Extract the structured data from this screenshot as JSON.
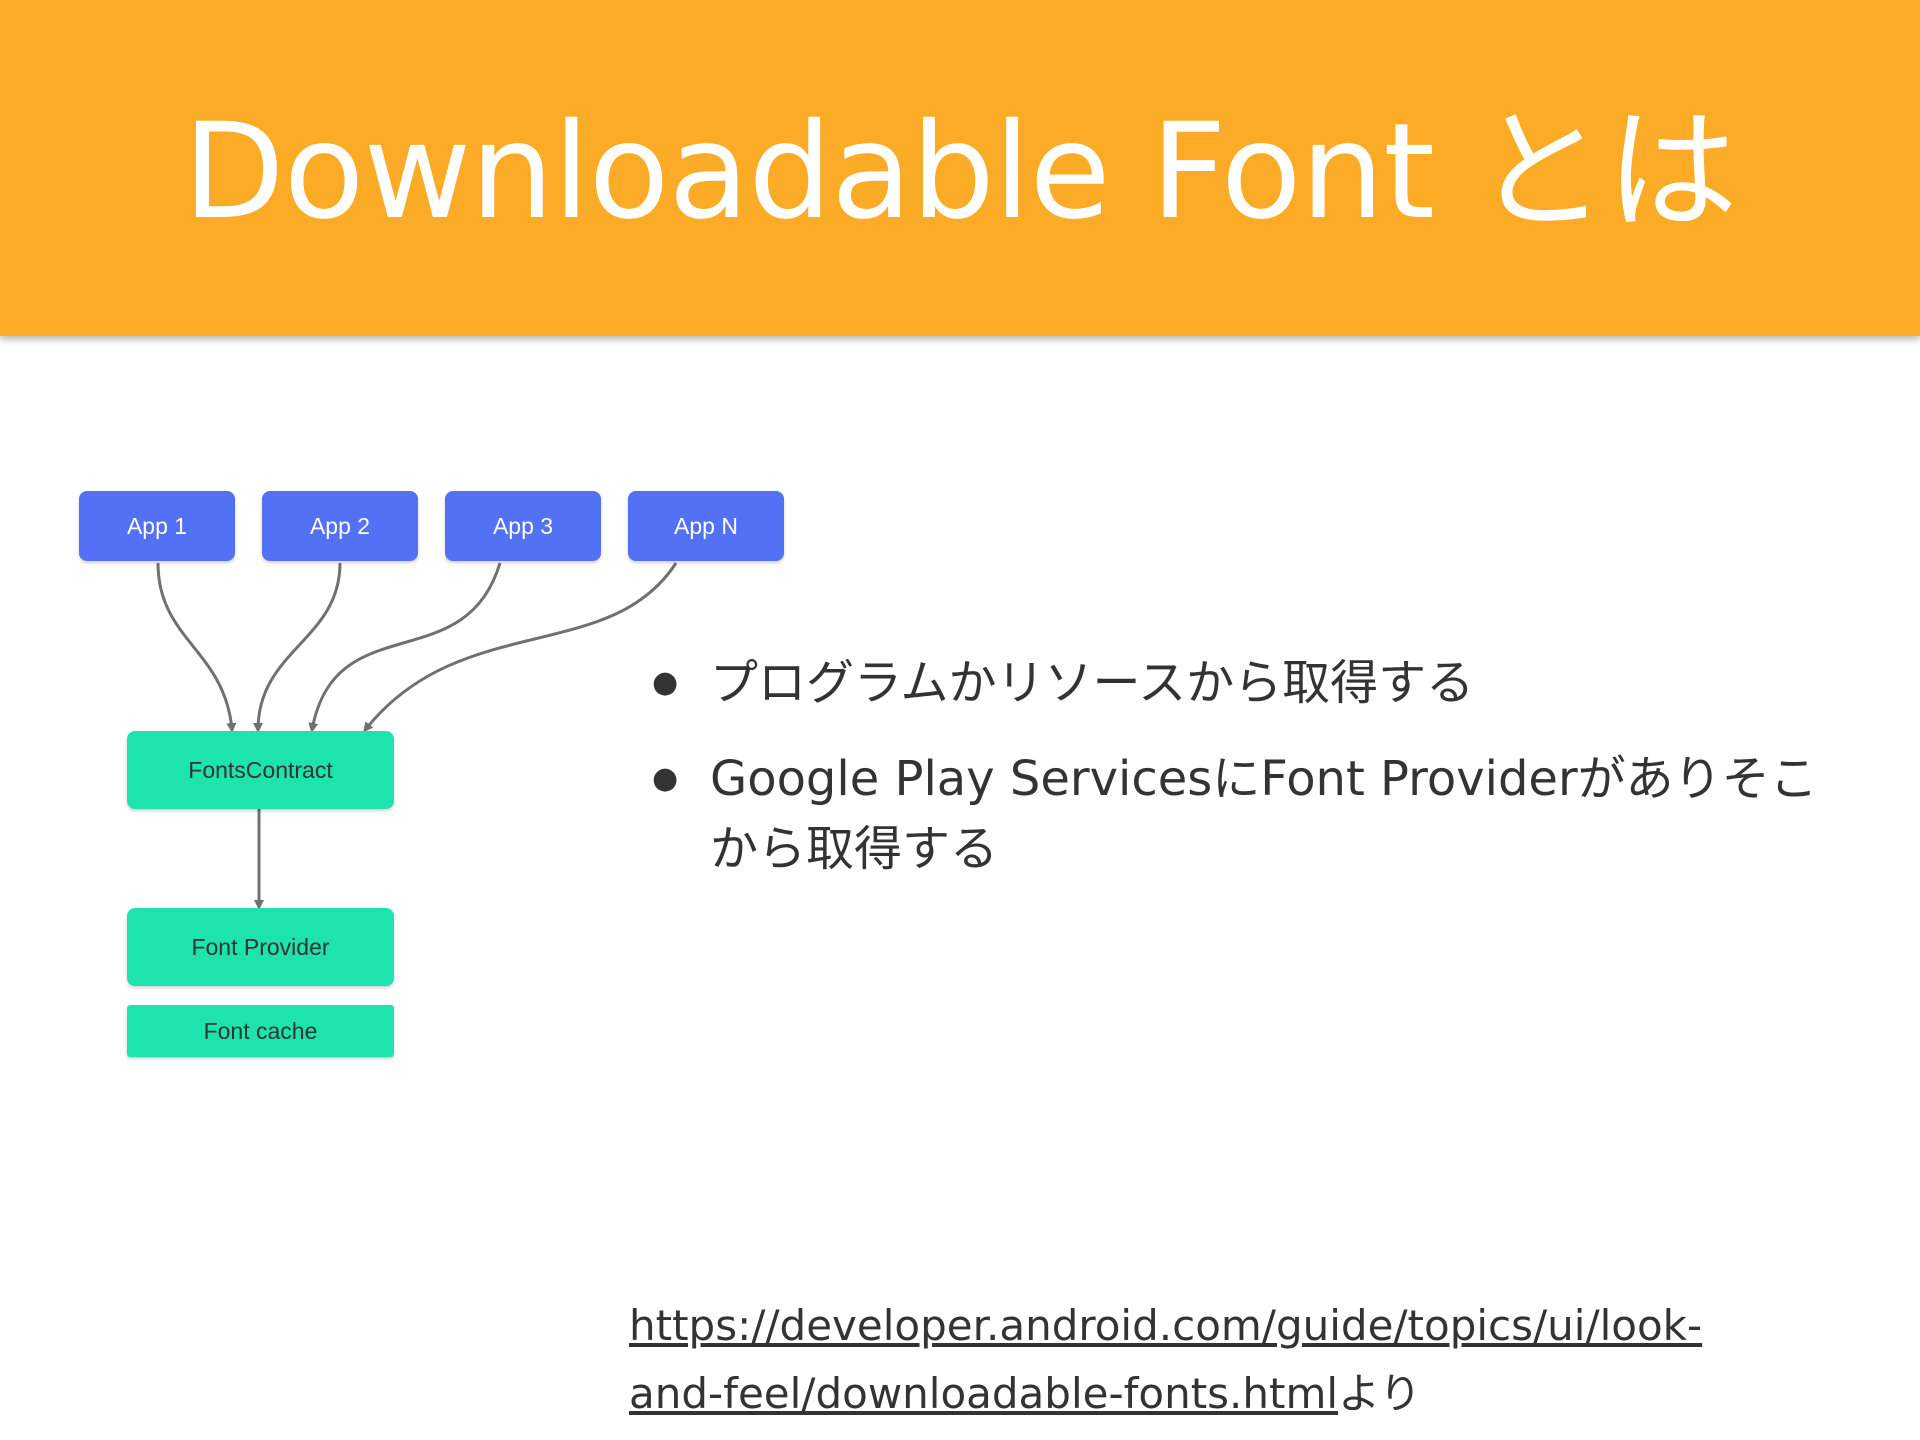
{
  "slide": {
    "title": "Downloadable Font とは",
    "header_color": "#fcab26"
  },
  "diagram": {
    "apps": [
      "App 1",
      "App 2",
      "App 3",
      "App N"
    ],
    "fonts_contract": "FontsContract",
    "font_provider": "Font Provider",
    "font_cache": "Font cache",
    "app_color": "#5271f5",
    "component_color": "#1de3ad"
  },
  "bullets": [
    "プログラムかリソースから取得する",
    "Google Play ServicesにFont Providerがありそこから取得する"
  ],
  "source": {
    "link_text": "https://developer.android.com/guide/topics/ui/look-and-feel/downloadable-fonts.html",
    "suffix": "より"
  }
}
